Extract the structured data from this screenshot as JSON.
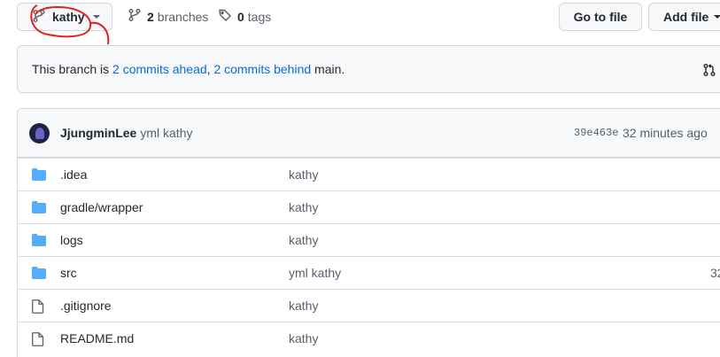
{
  "toolbar": {
    "branch_name": "kathy",
    "branches_count": "2",
    "branches_label": "branches",
    "tags_count": "0",
    "tags_label": "tags",
    "goto_file_label": "Go to file",
    "add_file_label": "Add file"
  },
  "compare": {
    "prefix": "This branch is ",
    "ahead": "2 commits ahead",
    "sep": ", ",
    "behind": "2 commits behind",
    "base": " main."
  },
  "commit": {
    "author": "JjungminLee",
    "message": "yml kathy",
    "sha": "39e463e",
    "time": "32 minutes ago"
  },
  "files": [
    {
      "name": ".idea",
      "message": "kathy",
      "type": "folder"
    },
    {
      "name": "gradle/wrapper",
      "message": "kathy",
      "type": "folder"
    },
    {
      "name": "logs",
      "message": "kathy",
      "type": "folder"
    },
    {
      "name": "src",
      "message": "yml kathy",
      "type": "folder",
      "time": "32"
    },
    {
      "name": ".gitignore",
      "message": "kathy",
      "type": "file"
    },
    {
      "name": "README.md",
      "message": "kathy",
      "type": "file"
    }
  ],
  "icons": {
    "branch": "git-branch-icon",
    "tag": "tag-icon",
    "folder": "folder-icon",
    "file": "file-icon",
    "pull_request": "pull-request-icon"
  },
  "colors": {
    "folder": "#54aeff",
    "link": "#0969da",
    "annotation": "#e5201f"
  }
}
